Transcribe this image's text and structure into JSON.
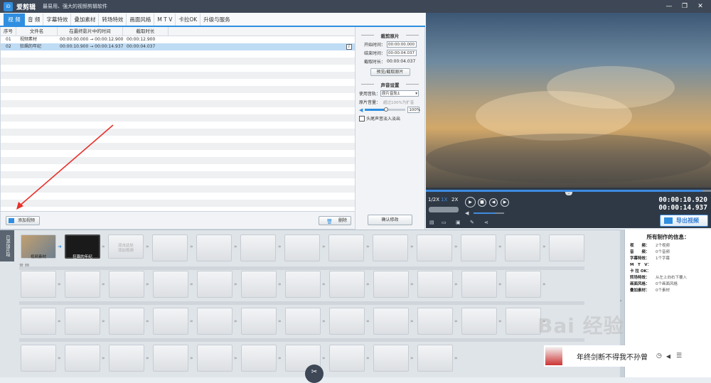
{
  "window": {
    "app_icon_text": "iD",
    "app_name": "爱剪辑",
    "app_subtitle": "最易用、强大的视频剪辑软件",
    "controls": [
      "—",
      "❐",
      "✕"
    ]
  },
  "tabs": [
    {
      "label": "视 频",
      "active": true
    },
    {
      "label": "音 频"
    },
    {
      "label": "字幕特效"
    },
    {
      "label": "叠加素材"
    },
    {
      "label": "转场特效"
    },
    {
      "label": "画面风格"
    },
    {
      "label": "M T V"
    },
    {
      "label": "卡拉OK"
    },
    {
      "label": "升级与服务"
    }
  ],
  "table": {
    "headers": [
      "序号",
      "文件名",
      "在最终影片中的时间",
      "截取时长"
    ],
    "rows": [
      {
        "num": "01",
        "name": "视频素材",
        "time": "00:00:00.000 → 00:00:12.900",
        "dur": "00:00:12.900"
      },
      {
        "num": "02",
        "name": "狂飙的年纪",
        "time": "00:00:10.900 → 00:00:14.937",
        "dur": "00:00:04.037",
        "selected": true
      }
    ]
  },
  "settings": {
    "clip_title": "裁剪原片",
    "start_label": "开始时间：",
    "start_value": "00:00:00.000",
    "end_label": "结束时间：",
    "end_value": "00:00:04.037",
    "dur_label": "截取时长：",
    "dur_value": "00:00:04.037",
    "preview_btn": "预览/截取原片",
    "audio_title": "声音设置",
    "track_label": "使用音轨：",
    "track_value": "原片音轨1",
    "vol_label": "原片音量：",
    "vol_hint": "超过100%为扩音",
    "vol_value": "100%",
    "fade_label": "头尾声音淡入淡出"
  },
  "bottom": {
    "add_btn": "添加视频",
    "delete_btn": "删除",
    "confirm_btn": "确认修改"
  },
  "player": {
    "speeds": [
      "1/2X",
      "1X",
      "2X"
    ],
    "active_speed": "1X",
    "time_current": "00:00:10.920",
    "time_total": "00:00:14.937",
    "export_btn": "导出视频",
    "progress": 0.97,
    "volume": 0.7
  },
  "timeline": {
    "vtab": "已添加片段",
    "clip1": "视频素材",
    "clip2": "狂飙的年纪",
    "add_hint1": "双击此处",
    "add_hint2": "添加视频",
    "audio_lane": "音 频"
  },
  "info": {
    "title": "所有制作的信息：",
    "rows": [
      {
        "k": "视　　频：",
        "v": "2个视频"
      },
      {
        "k": "音　　频：",
        "v": "0个音频"
      },
      {
        "k": "字幕特效：",
        "v": "1个字幕"
      },
      {
        "k": "M　T　V：",
        "v": ""
      },
      {
        "k": "卡 拉 OK：",
        "v": ""
      },
      {
        "k": "转场特效：",
        "v": "从左上向右下覆入"
      },
      {
        "k": "画面风格：",
        "v": "0个画面风格"
      },
      {
        "k": "叠加素材：",
        "v": "0个素材"
      }
    ]
  },
  "promo": {
    "text": "年终剑断不得我不孙曾"
  },
  "watermark": "Bai 经验",
  "colors": {
    "accent": "#2f8ee0",
    "dark": "#3d4756"
  }
}
